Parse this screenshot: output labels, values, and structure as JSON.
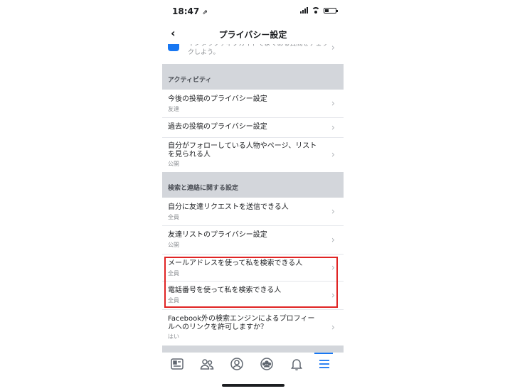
{
  "status_bar": {
    "time": "18:47",
    "arrow": "⇗"
  },
  "nav": {
    "back_glyph": "‹",
    "title": "プライバシー設定"
  },
  "partial_item": {
    "text": "インタラクティブガイドでよくある質問をチェックしよう。"
  },
  "sections": [
    {
      "label": "アクティビティ"
    },
    {
      "label": "検索と連絡に関する設定"
    }
  ],
  "activity_items": [
    {
      "title": "今後の投稿のプライバシー設定",
      "subtitle": "友達"
    },
    {
      "title": "過去の投稿のプライバシー設定",
      "subtitle": ""
    },
    {
      "title": "自分がフォローしている人物やページ、リストを見られる人",
      "subtitle": "公開"
    }
  ],
  "search_items": [
    {
      "title": "自分に友達リクエストを送信できる人",
      "subtitle": "全員"
    },
    {
      "title": "友達リストのプライバシー設定",
      "subtitle": "公開"
    },
    {
      "title": "メールアドレスを使って私を検索できる人",
      "subtitle": "全員"
    },
    {
      "title": "電話番号を使って私を検索できる人",
      "subtitle": "全員"
    },
    {
      "title": "Facebook外の検索エンジンによるプロフィールへのリンクを許可しますか？",
      "subtitle": "はい"
    }
  ],
  "chevron_glyph": "›",
  "tabs": [
    {
      "icon": "news-feed-icon"
    },
    {
      "icon": "friends-icon"
    },
    {
      "icon": "profile-icon"
    },
    {
      "icon": "groups-icon"
    },
    {
      "icon": "notifications-bell-icon"
    },
    {
      "icon": "menu-icon",
      "active": true
    }
  ],
  "colors": {
    "accent": "#1877f2",
    "highlight": "#e02424",
    "section_bg": "#d3d6db"
  }
}
